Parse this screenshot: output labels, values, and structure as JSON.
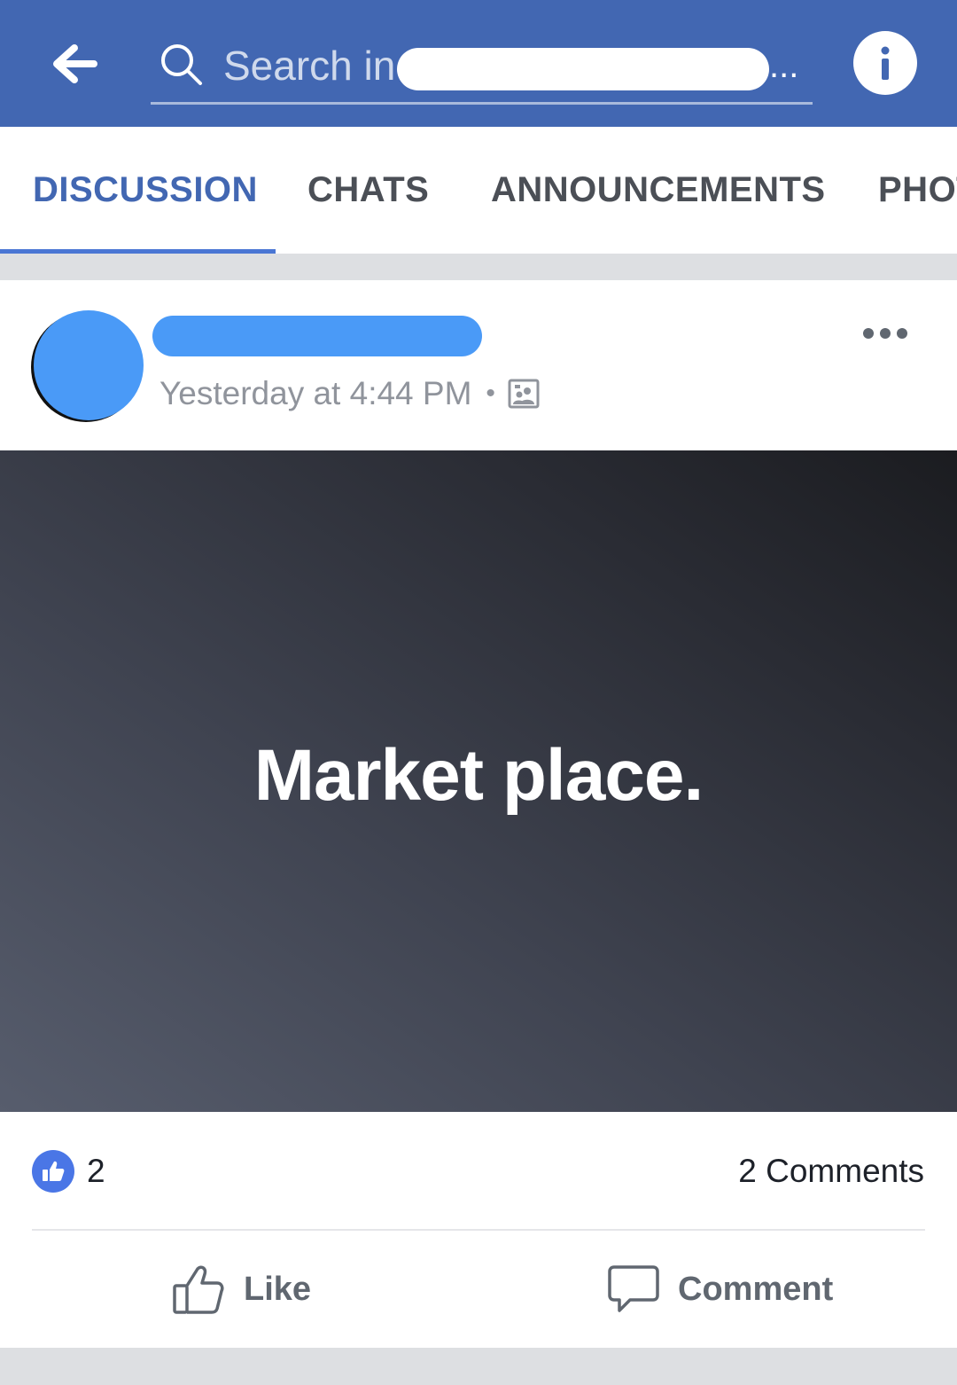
{
  "header": {
    "search_placeholder": "Search in",
    "search_suffix": "..."
  },
  "tabs": [
    {
      "label": "DISCUSSION",
      "active": true
    },
    {
      "label": "CHATS",
      "active": false
    },
    {
      "label": "ANNOUNCEMENTS",
      "active": false
    },
    {
      "label": "PHOTOS",
      "active": false
    }
  ],
  "post": {
    "timestamp": "Yesterday at 4:44 PM",
    "separator": "•",
    "text": "Market place.",
    "like_count": "2",
    "comments_count": "2 Comments",
    "actions": {
      "like_label": "Like",
      "comment_label": "Comment"
    }
  },
  "colors": {
    "brand_blue": "#4267b2",
    "active_tab": "#4267b2",
    "redaction_blue": "#4a9af7"
  },
  "icons": {
    "back": "back-arrow-icon",
    "search": "search-icon",
    "info": "info-icon",
    "more": "more-dots-icon",
    "audience": "group-photo-icon",
    "like_badge": "thumbs-up-icon",
    "like": "thumbs-up-outline-icon",
    "comment": "speech-bubble-icon"
  }
}
